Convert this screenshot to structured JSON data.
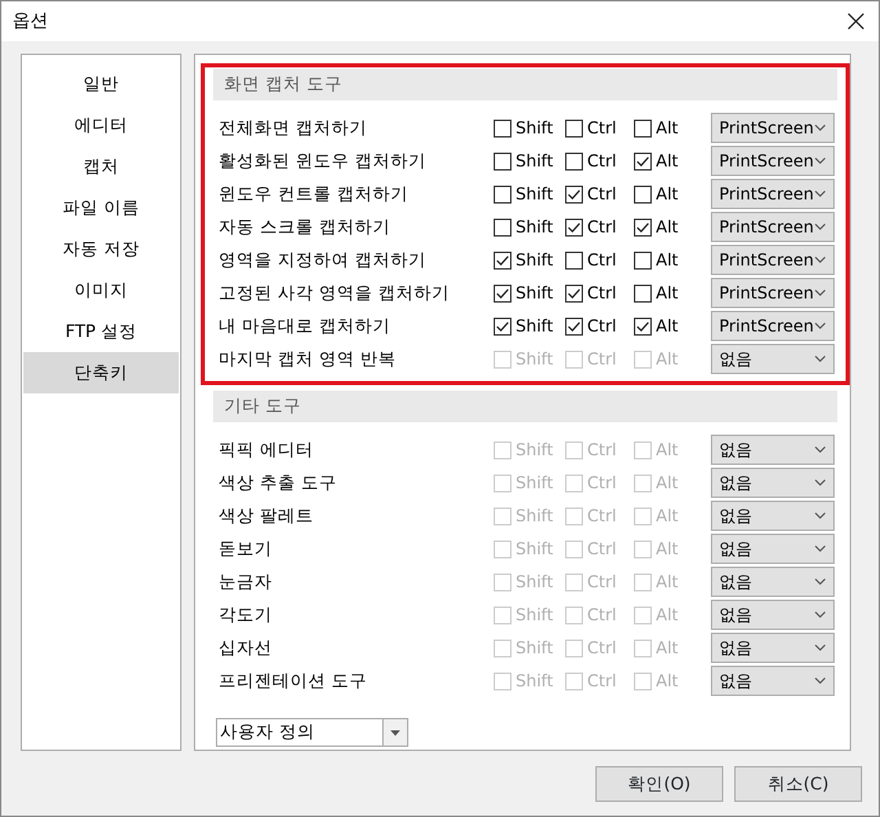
{
  "window": {
    "title": "옵션"
  },
  "sidebar": {
    "items": [
      {
        "label": "일반",
        "selected": false
      },
      {
        "label": "에디터",
        "selected": false
      },
      {
        "label": "캡처",
        "selected": false
      },
      {
        "label": "파일 이름",
        "selected": false
      },
      {
        "label": "자동 저장",
        "selected": false
      },
      {
        "label": "이미지",
        "selected": false
      },
      {
        "label": "FTP 설정",
        "selected": false
      },
      {
        "label": "단축키",
        "selected": true
      }
    ]
  },
  "sections": [
    {
      "title": "화면 캡처 도구",
      "highlighted": true,
      "rows": [
        {
          "label": "전체화면 캡처하기",
          "disabled": false,
          "modifiers": [
            {
              "label": "Shift",
              "checked": false
            },
            {
              "label": "Ctrl",
              "checked": false
            },
            {
              "label": "Alt",
              "checked": false
            }
          ],
          "key": "PrintScreen"
        },
        {
          "label": "활성화된 윈도우 캡처하기",
          "disabled": false,
          "modifiers": [
            {
              "label": "Shift",
              "checked": false
            },
            {
              "label": "Ctrl",
              "checked": false
            },
            {
              "label": "Alt",
              "checked": true
            }
          ],
          "key": "PrintScreen"
        },
        {
          "label": "윈도우 컨트롤 캡처하기",
          "disabled": false,
          "modifiers": [
            {
              "label": "Shift",
              "checked": false
            },
            {
              "label": "Ctrl",
              "checked": true
            },
            {
              "label": "Alt",
              "checked": false
            }
          ],
          "key": "PrintScreen"
        },
        {
          "label": "자동 스크롤 캡처하기",
          "disabled": false,
          "modifiers": [
            {
              "label": "Shift",
              "checked": false
            },
            {
              "label": "Ctrl",
              "checked": true
            },
            {
              "label": "Alt",
              "checked": true
            }
          ],
          "key": "PrintScreen"
        },
        {
          "label": "영역을 지정하여 캡처하기",
          "disabled": false,
          "modifiers": [
            {
              "label": "Shift",
              "checked": true
            },
            {
              "label": "Ctrl",
              "checked": false
            },
            {
              "label": "Alt",
              "checked": false
            }
          ],
          "key": "PrintScreen"
        },
        {
          "label": "고정된 사각 영역을 캡처하기",
          "disabled": false,
          "modifiers": [
            {
              "label": "Shift",
              "checked": true
            },
            {
              "label": "Ctrl",
              "checked": true
            },
            {
              "label": "Alt",
              "checked": false
            }
          ],
          "key": "PrintScreen"
        },
        {
          "label": "내 마음대로 캡처하기",
          "disabled": false,
          "modifiers": [
            {
              "label": "Shift",
              "checked": true
            },
            {
              "label": "Ctrl",
              "checked": true
            },
            {
              "label": "Alt",
              "checked": true
            }
          ],
          "key": "PrintScreen"
        },
        {
          "label": "마지막 캡처 영역 반복",
          "disabled": true,
          "modifiers": [
            {
              "label": "Shift",
              "checked": false
            },
            {
              "label": "Ctrl",
              "checked": false
            },
            {
              "label": "Alt",
              "checked": false
            }
          ],
          "key": "없음"
        }
      ]
    },
    {
      "title": "기타 도구",
      "highlighted": false,
      "rows": [
        {
          "label": "픽픽 에디터",
          "disabled": true,
          "modifiers": [
            {
              "label": "Shift",
              "checked": false
            },
            {
              "label": "Ctrl",
              "checked": false
            },
            {
              "label": "Alt",
              "checked": false
            }
          ],
          "key": "없음"
        },
        {
          "label": "색상 추출 도구",
          "disabled": true,
          "modifiers": [
            {
              "label": "Shift",
              "checked": false
            },
            {
              "label": "Ctrl",
              "checked": false
            },
            {
              "label": "Alt",
              "checked": false
            }
          ],
          "key": "없음"
        },
        {
          "label": "색상 팔레트",
          "disabled": true,
          "modifiers": [
            {
              "label": "Shift",
              "checked": false
            },
            {
              "label": "Ctrl",
              "checked": false
            },
            {
              "label": "Alt",
              "checked": false
            }
          ],
          "key": "없음"
        },
        {
          "label": "돋보기",
          "disabled": true,
          "modifiers": [
            {
              "label": "Shift",
              "checked": false
            },
            {
              "label": "Ctrl",
              "checked": false
            },
            {
              "label": "Alt",
              "checked": false
            }
          ],
          "key": "없음"
        },
        {
          "label": "눈금자",
          "disabled": true,
          "modifiers": [
            {
              "label": "Shift",
              "checked": false
            },
            {
              "label": "Ctrl",
              "checked": false
            },
            {
              "label": "Alt",
              "checked": false
            }
          ],
          "key": "없음"
        },
        {
          "label": "각도기",
          "disabled": true,
          "modifiers": [
            {
              "label": "Shift",
              "checked": false
            },
            {
              "label": "Ctrl",
              "checked": false
            },
            {
              "label": "Alt",
              "checked": false
            }
          ],
          "key": "없음"
        },
        {
          "label": "십자선",
          "disabled": true,
          "modifiers": [
            {
              "label": "Shift",
              "checked": false
            },
            {
              "label": "Ctrl",
              "checked": false
            },
            {
              "label": "Alt",
              "checked": false
            }
          ],
          "key": "없음"
        },
        {
          "label": "프리젠테이션 도구",
          "disabled": true,
          "modifiers": [
            {
              "label": "Shift",
              "checked": false
            },
            {
              "label": "Ctrl",
              "checked": false
            },
            {
              "label": "Alt",
              "checked": false
            }
          ],
          "key": "없음"
        }
      ]
    }
  ],
  "preset": {
    "value": "사용자 정의"
  },
  "buttons": [
    "확인(O)",
    "취소(C)"
  ]
}
